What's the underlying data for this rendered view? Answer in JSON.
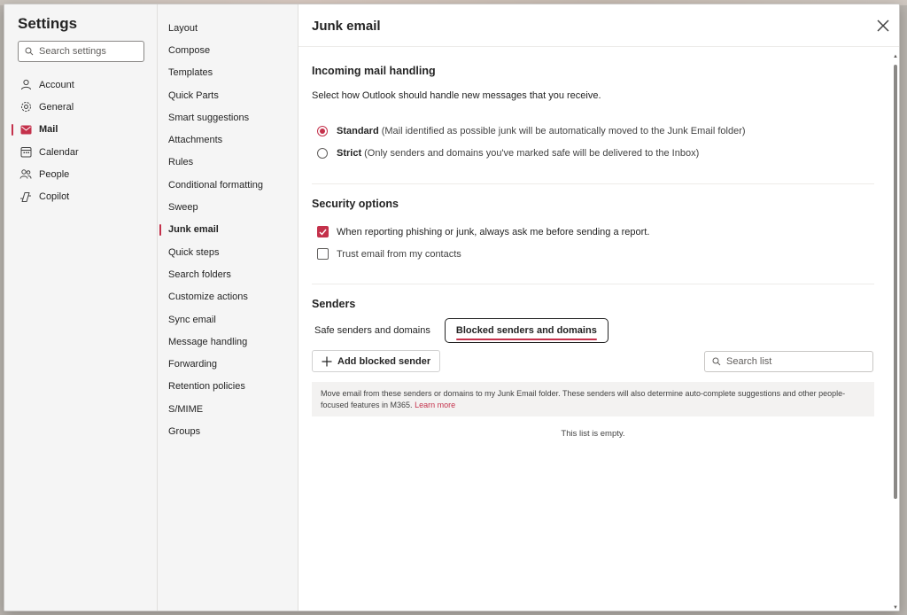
{
  "left_nav": {
    "title": "Settings",
    "search_placeholder": "Search settings",
    "items": [
      {
        "label": "Account",
        "icon": "person-icon"
      },
      {
        "label": "General",
        "icon": "gear-icon"
      },
      {
        "label": "Mail",
        "icon": "mail-icon",
        "active": true
      },
      {
        "label": "Calendar",
        "icon": "calendar-icon"
      },
      {
        "label": "People",
        "icon": "people-icon"
      },
      {
        "label": "Copilot",
        "icon": "copilot-icon"
      }
    ]
  },
  "mid_nav": {
    "items": [
      "Layout",
      "Compose",
      "Templates",
      "Quick Parts",
      "Smart suggestions",
      "Attachments",
      "Rules",
      "Conditional formatting",
      "Sweep",
      "Junk email",
      "Quick steps",
      "Search folders",
      "Customize actions",
      "Sync email",
      "Message handling",
      "Forwarding",
      "Retention policies",
      "S/MIME",
      "Groups"
    ],
    "active_index": 9
  },
  "main": {
    "title": "Junk email",
    "incoming": {
      "title": "Incoming mail handling",
      "description": "Select how Outlook should handle new messages that you receive.",
      "standard_label": "Standard",
      "standard_desc": "(Mail identified as possible junk will be automatically moved to the Junk Email folder)",
      "strict_label": "Strict",
      "strict_desc": "(Only senders and domains you've marked safe will be delivered to the Inbox)",
      "selected": "Standard"
    },
    "security": {
      "title": "Security options",
      "ask_before_report": "When reporting phishing or junk, always ask me before sending a report.",
      "ask_checked": true,
      "trust_contacts": "Trust email from my contacts",
      "trust_checked": false
    },
    "senders": {
      "title": "Senders",
      "tab_safe": "Safe senders and domains",
      "tab_blocked": "Blocked senders and domains",
      "selected_tab": "Blocked senders and domains",
      "add_button": "Add blocked sender",
      "search_placeholder": "Search list",
      "info_text": "Move email from these senders or domains to my Junk Email folder. These senders will also determine auto-complete suggestions and other people-focused features in M365.",
      "learn_more": "Learn more",
      "empty_text": "This list is empty."
    }
  },
  "colors": {
    "accent": "#c4314b",
    "nav_bg": "#f5f5f5"
  }
}
